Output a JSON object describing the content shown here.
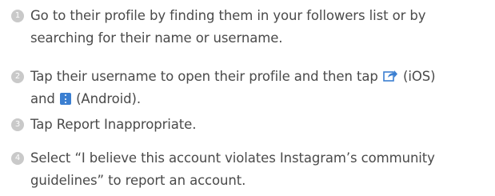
{
  "steps": [
    {
      "number": "1",
      "line1": "Go to their profile by finding them in your followers list or by",
      "line2": "searching for their name or username."
    },
    {
      "number": "2",
      "line1_pre": "Tap their username to open their profile and then tap",
      "line1_post": "(iOS)",
      "line2_pre": "and",
      "line2_post": "(Android).",
      "ios_icon": "share-icon",
      "android_icon": "more-options-icon"
    },
    {
      "number": "3",
      "line1": "Tap Report Inappropriate."
    },
    {
      "number": "4",
      "line1": "Select “I believe this account violates Instagram’s community",
      "line2": "guidelines” to report an account."
    }
  ],
  "colors": {
    "badge": "#c9c9c9",
    "text": "#4a4a4a",
    "icon_blue": "#3b7fd1"
  }
}
